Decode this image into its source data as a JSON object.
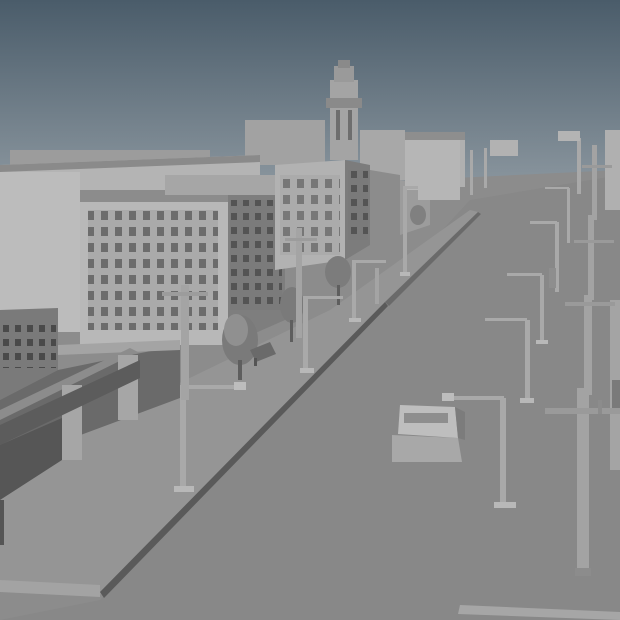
{
  "scene": {
    "description_visible_text": [],
    "palette": {
      "sky_top": "#4a5c6a",
      "sky_bottom": "#8f9aa2",
      "ground": "#8a8a8a",
      "road": "#878787",
      "sidewalk": "#9a9a9a",
      "building_light": "#b7b7b7",
      "building_mid": "#9e9e9e",
      "building_dark": "#6b6b6b",
      "window": "#5a5a5a",
      "pole": "#a9a9a9",
      "tree": "#7d7d7d",
      "shadow": "#4d4d4d"
    }
  }
}
